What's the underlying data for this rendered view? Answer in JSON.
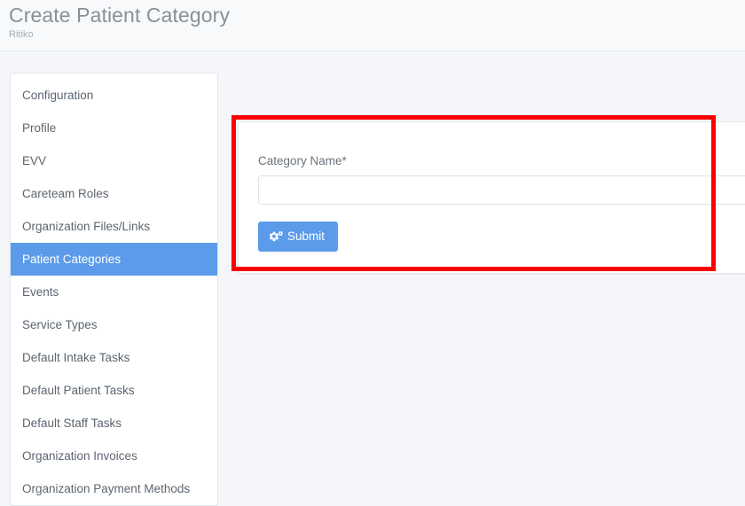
{
  "header": {
    "title": "Create Patient Category",
    "subtitle": "Ritiko"
  },
  "sidebar": {
    "items": [
      {
        "label": "Configuration",
        "active": false
      },
      {
        "label": "Profile",
        "active": false
      },
      {
        "label": "EVV",
        "active": false
      },
      {
        "label": "Careteam Roles",
        "active": false
      },
      {
        "label": "Organization Files/Links",
        "active": false
      },
      {
        "label": "Patient Categories",
        "active": true
      },
      {
        "label": "Events",
        "active": false
      },
      {
        "label": "Service Types",
        "active": false
      },
      {
        "label": "Default Intake Tasks",
        "active": false
      },
      {
        "label": "Default Patient Tasks",
        "active": false
      },
      {
        "label": "Default Staff Tasks",
        "active": false
      },
      {
        "label": "Organization Invoices",
        "active": false
      },
      {
        "label": "Organization Payment Methods",
        "active": false
      }
    ]
  },
  "form": {
    "category_name_label": "Category Name*",
    "category_name_value": "",
    "category_name_placeholder": "",
    "submit_label": "Submit",
    "submit_icon": "cogs-icon"
  },
  "colors": {
    "accent_blue": "#5b9bea",
    "annotation_red": "#fb0000",
    "page_background": "#f4f6f9",
    "card_background": "#ffffff",
    "title_gray": "#8a9099"
  }
}
